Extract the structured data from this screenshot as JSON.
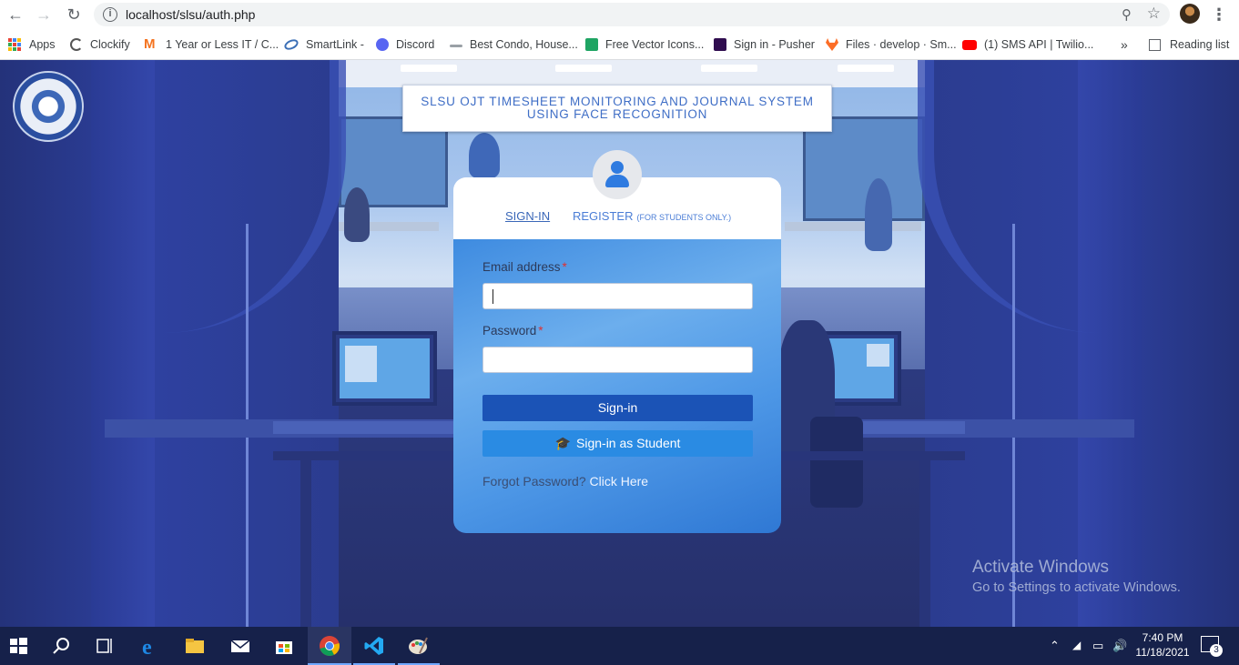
{
  "browser": {
    "url": "localhost/slsu/auth.php",
    "bookmarks": [
      {
        "label": "Apps",
        "icon": "apps-grid-icon"
      },
      {
        "label": "Clockify",
        "icon": "clockify-icon"
      },
      {
        "label": "1 Year or Less IT / C...",
        "icon": "m-logo-icon"
      },
      {
        "label": "SmartLink -",
        "icon": "smartlink-icon"
      },
      {
        "label": "Discord",
        "icon": "discord-icon"
      },
      {
        "label": "Best Condo, House...",
        "icon": "condo-icon"
      },
      {
        "label": "Free Vector Icons...",
        "icon": "vector-icons-icon"
      },
      {
        "label": "Sign in - Pusher",
        "icon": "pusher-icon"
      },
      {
        "label": "Files · develop · Sm...",
        "icon": "gitlab-icon"
      },
      {
        "label": "(1) SMS API | Twilio...",
        "icon": "youtube-icon"
      }
    ],
    "more_bookmarks": "»",
    "reading_list": "Reading list"
  },
  "page": {
    "title_line1": "SLSU OJT TIMESHEET MONITORING AND JOURNAL SYSTEM",
    "title_line2": "USING FACE RECOGNITION",
    "tabs": {
      "signin": "SIGN-IN",
      "register": "REGISTER",
      "register_note": "(FOR STUDENTS ONLY.)"
    },
    "form": {
      "email_label": "Email address",
      "password_label": "Password",
      "required_mark": "*",
      "email_value": "",
      "password_value": "",
      "signin_button": "Sign-in",
      "student_button": "Sign-in as Student",
      "forgot_text": "Forgot Password?",
      "forgot_link": "Click Here"
    }
  },
  "watermark": {
    "line1": "Activate Windows",
    "line2": "Go to Settings to activate Windows."
  },
  "taskbar": {
    "time": "7:40 PM",
    "date": "11/18/2021",
    "notifications": "3"
  },
  "colors": {
    "primary_button": "#1b53b6",
    "student_button": "#2a8be3",
    "title_text": "#3f6ec6",
    "card_gradient_start": "#3e8be0",
    "background": "#2c3a7f"
  }
}
